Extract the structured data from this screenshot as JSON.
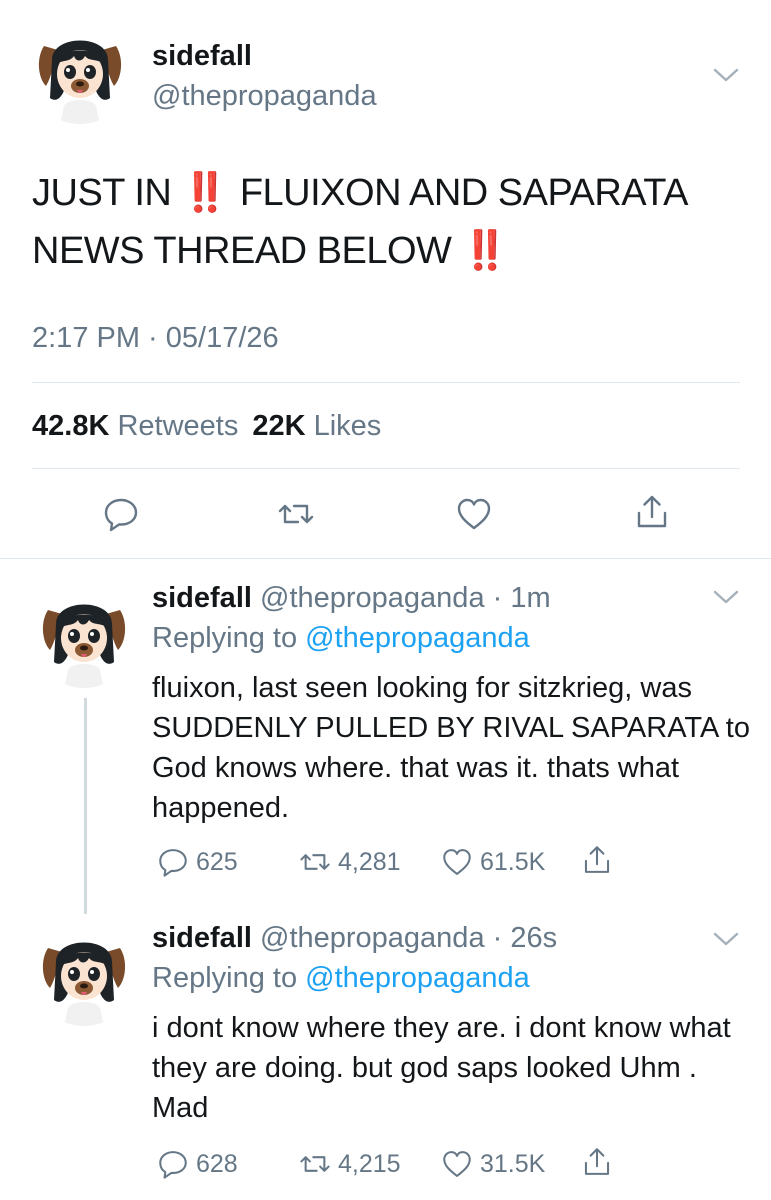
{
  "main_tweet": {
    "name": "sidefall",
    "handle": "@thepropaganda",
    "text_part1": "JUST IN ",
    "emoji_1": "‼️",
    "text_part2": " FLUIXON AND SAPARATA NEWS THREAD BELOW ",
    "emoji_2": "‼️",
    "timestamp": "2:17 PM · 05/17/26",
    "retweets_count": "42.8K",
    "retweets_label": "Retweets",
    "likes_count": "22K",
    "likes_label": "Likes",
    "icons": [
      "reply-icon",
      "retweet-icon",
      "like-icon",
      "share-icon",
      "chevron-down-icon"
    ]
  },
  "replies": [
    {
      "name": "sidefall",
      "handle": "@thepropaganda",
      "time": "1m",
      "replying_label": "Replying to",
      "replying_to": "@thepropaganda",
      "text": "fluixon, last seen looking for sitzkrieg, was SUDDENLY PULLED BY RIVAL SAPARATA to God knows where. that was it. thats what happened.",
      "reply_count": "625",
      "retweet_count": "4,281",
      "like_count": "61.5K"
    },
    {
      "name": "sidefall",
      "handle": "@thepropaganda",
      "time": "26s",
      "replying_label": "Replying to",
      "replying_to": "@thepropaganda",
      "text": "i dont know where they are. i dont know what they are doing. but god saps looked Uhm . Mad",
      "reply_count": "628",
      "retweet_count": "4,215",
      "like_count": "31.5K"
    }
  ],
  "colors": {
    "text": "#14171a",
    "secondary": "#657786",
    "link": "#1da1f2",
    "emoji_red": "#e0151a",
    "divider": "#e1e8ed"
  }
}
